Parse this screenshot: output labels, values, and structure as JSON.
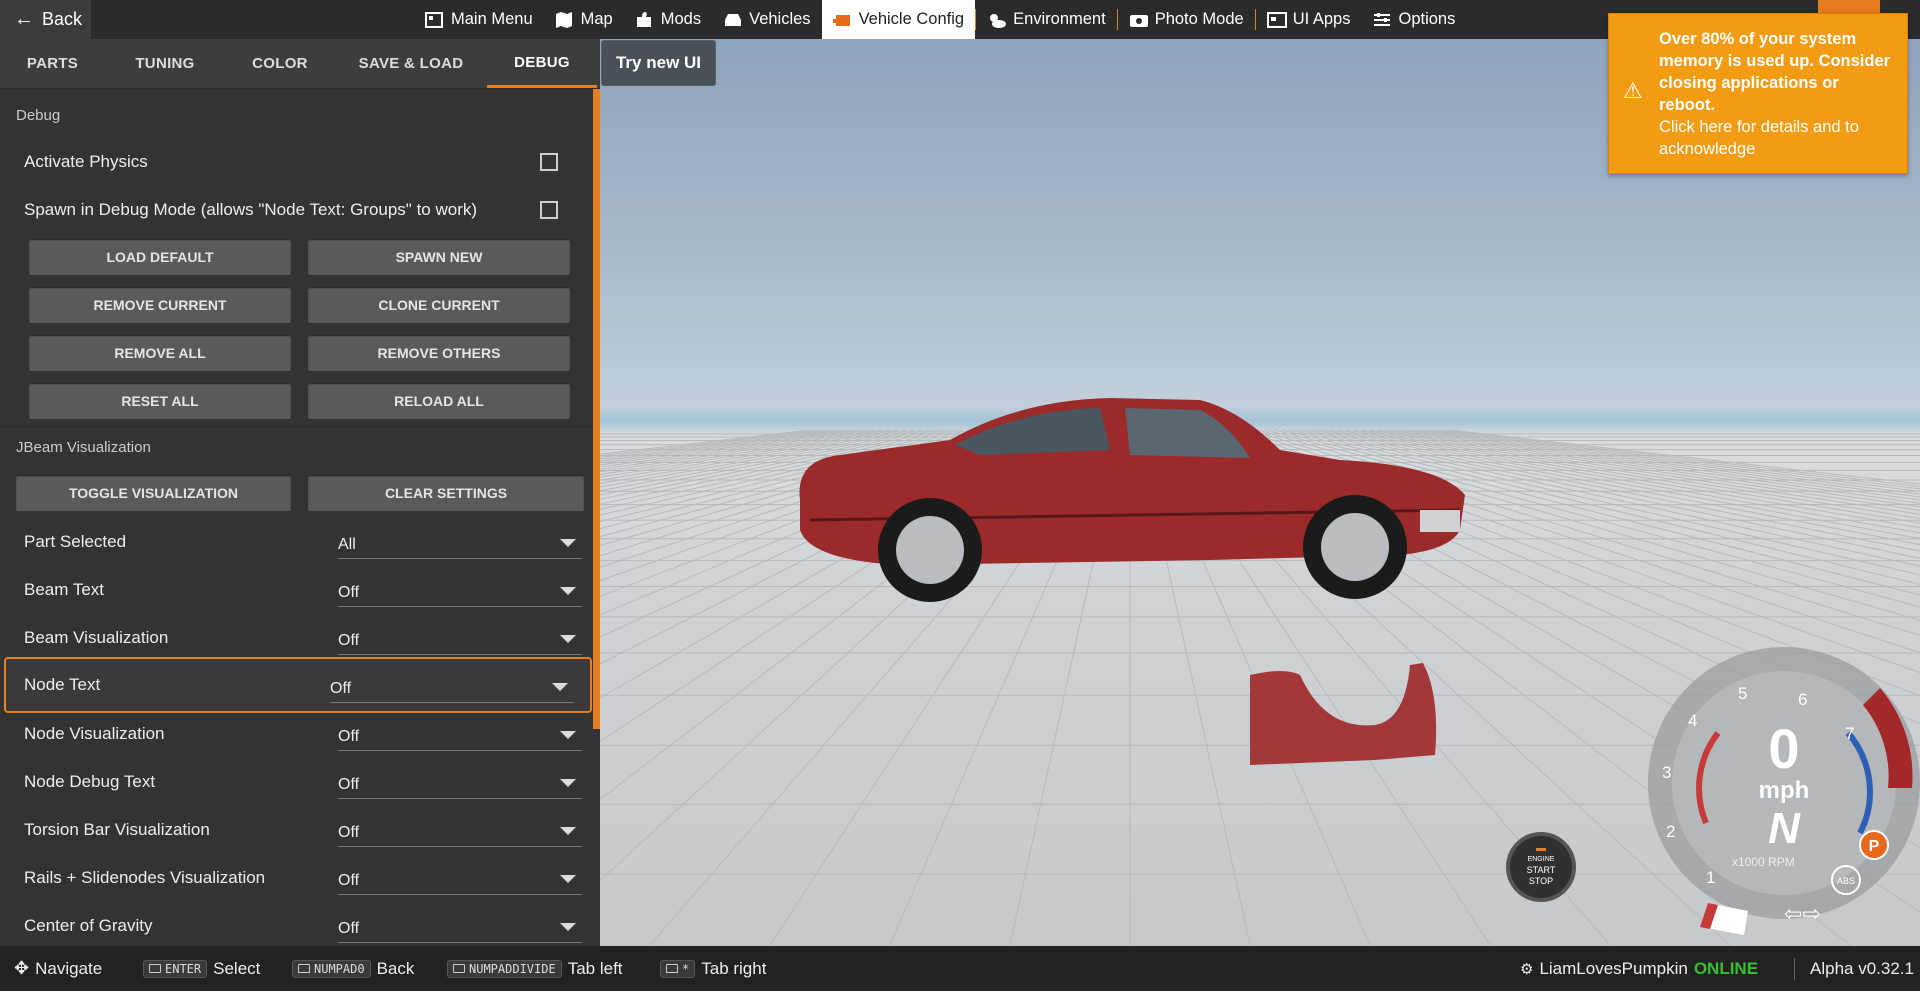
{
  "topbar": {
    "back_label": "Back",
    "menu": [
      {
        "label": "Main Menu",
        "icon": "main-menu-icon"
      },
      {
        "label": "Map",
        "icon": "map-icon"
      },
      {
        "label": "Mods",
        "icon": "puzzle-icon"
      },
      {
        "label": "Vehicles",
        "icon": "car-icon"
      },
      {
        "label": "Vehicle Config",
        "icon": "engine-icon",
        "active": true
      },
      {
        "label": "Environment",
        "icon": "weather-icon"
      },
      {
        "label": "Photo Mode",
        "icon": "camera-icon"
      },
      {
        "label": "UI Apps",
        "icon": "ui-apps-icon"
      },
      {
        "label": "Options",
        "icon": "sliders-icon"
      }
    ]
  },
  "panel": {
    "tabs": [
      "PARTS",
      "TUNING",
      "COLOR",
      "SAVE & LOAD",
      "DEBUG"
    ],
    "active_tab": "DEBUG",
    "try_new_ui": "Try new UI",
    "debug_title": "Debug",
    "activate_physics": "Activate Physics",
    "spawn_debug": "Spawn in Debug Mode (allows \"Node Text: Groups\" to work)",
    "buttons": {
      "load_default": "LOAD DEFAULT",
      "spawn_new": "SPAWN NEW",
      "remove_current": "REMOVE CURRENT",
      "clone_current": "CLONE CURRENT",
      "remove_all": "REMOVE ALL",
      "remove_others": "REMOVE OTHERS",
      "reset_all": "RESET ALL",
      "reload_all": "RELOAD ALL",
      "toggle_visualization": "TOGGLE VISUALIZATION",
      "clear_settings": "CLEAR SETTINGS"
    },
    "jbeam_title": "JBeam Visualization",
    "settings": [
      {
        "label": "Part Selected",
        "value": "All"
      },
      {
        "label": "Beam Text",
        "value": "Off"
      },
      {
        "label": "Beam Visualization",
        "value": "Off"
      },
      {
        "label": "Node Text",
        "value": "Off"
      },
      {
        "label": "Node Visualization",
        "value": "Off"
      },
      {
        "label": "Node Debug Text",
        "value": "Off"
      },
      {
        "label": "Torsion Bar Visualization",
        "value": "Off"
      },
      {
        "label": "Rails + Slidenodes Visualization",
        "value": "Off"
      },
      {
        "label": "Center of Gravity",
        "value": "Off"
      }
    ]
  },
  "notification": {
    "title": "Over 80% of your system memory is used up. Consider closing applications or reboot.",
    "body": "Click here for details and to acknowledge",
    "color": "#f39b12"
  },
  "hud": {
    "speed": "0",
    "unit": "mph",
    "gear": "N",
    "rpm_label": "x1000 RPM",
    "ticks": [
      "1",
      "2",
      "3",
      "4",
      "5",
      "6",
      "7"
    ],
    "parking": "P",
    "abs": "ABS",
    "engine_line1": "ENGINE",
    "engine_line2": "START",
    "engine_line3": "STOP"
  },
  "bottombar": {
    "navigate": "Navigate",
    "enter_key": "ENTER",
    "select": "Select",
    "numpad0_key": "NUMPAD0",
    "back": "Back",
    "numpaddiv_key": "NUMPADDIVIDE",
    "tab_left": "Tab left",
    "star_key": "*",
    "tab_right": "Tab right",
    "username": "LiamLovesPumpkin",
    "status": "ONLINE",
    "version": "Alpha v0.32.1"
  }
}
